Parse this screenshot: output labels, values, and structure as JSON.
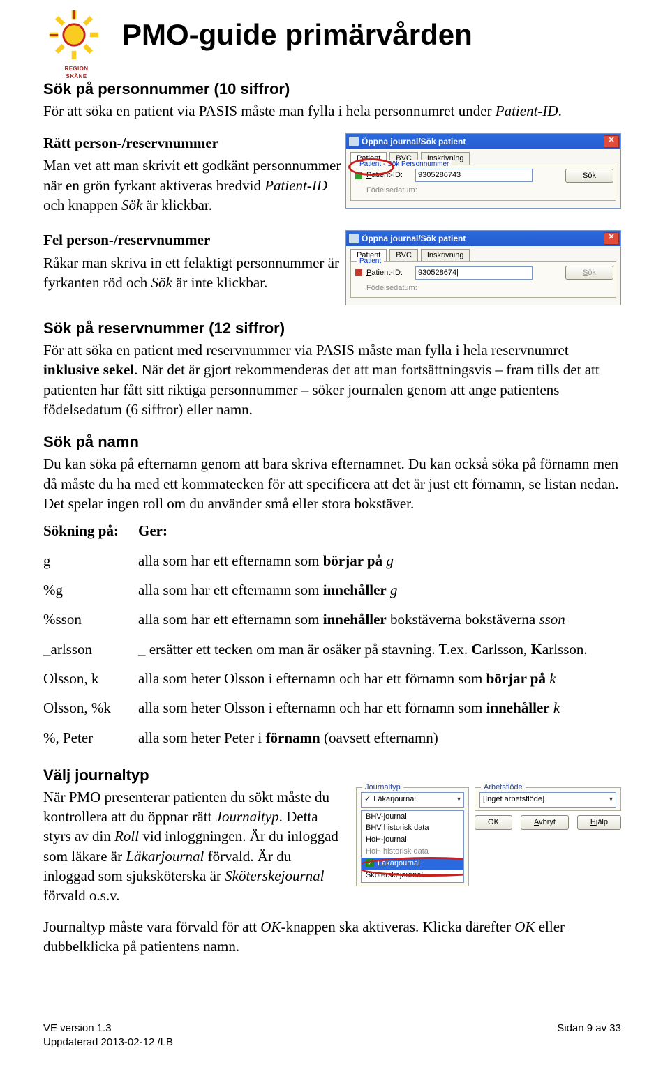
{
  "header": {
    "logo_region": "REGION",
    "logo_skane": "SKÅNE",
    "title": "PMO-guide primärvården"
  },
  "sec1": {
    "heading": "Sök på personnummer (10 siffror)",
    "p1a": "För att söka en patient via PASIS måste man fylla i hela personnumret under ",
    "p1b": "Patient-ID",
    "p1c": "."
  },
  "sec2": {
    "bold": "Rätt person-/reservnummer",
    "p1a": "Man vet att man skrivit ett godkänt personnummer när en grön fyrkant aktiveras bredvid ",
    "p1b": "Patient-ID",
    "p1c": " och knappen ",
    "p1d": "Sök",
    "p1e": " är klickbar."
  },
  "sec3": {
    "bold": "Fel person-/reservnummer",
    "p1a": "Råkar man skriva in ett felaktigt personnummer är fyrkanten röd och ",
    "p1b": "Sök",
    "p1c": " är inte klickbar."
  },
  "sec4": {
    "heading": "Sök på reservnummer (12 siffror)",
    "p1a": "För att söka en patient med reservnummer via PASIS måste man fylla i hela reservnumret ",
    "p1b": "inklusive sekel",
    "p1c": ". När det är gjort rekommenderas det att man fortsättningsvis – fram tills det att patienten har fått sitt riktiga personnummer – söker journalen genom att ange patientens födelsedatum (6 siffror) eller namn."
  },
  "sec5": {
    "heading": "Sök på namn",
    "p1": "Du kan söka på efternamn genom att bara skriva efternamnet. Du kan också söka på förnamn men då måste du ha med ett kommatecken för att specificera att det är just ett förnamn, se listan nedan. Det spelar ingen roll om du använder små eller stora bokstäver."
  },
  "table": {
    "h1": "Sökning på:",
    "h2": "Ger:",
    "rows": [
      {
        "k": "g",
        "v_a": "alla som har ett efternamn som ",
        "v_b": "börjar på",
        "v_c": " g",
        "v_it": true
      },
      {
        "k": "%g",
        "v_a": "alla som har ett efternamn som ",
        "v_b": "innehåller",
        "v_c": " g",
        "v_it": true
      },
      {
        "k": "%sson",
        "v_a": "alla som har ett efternamn som ",
        "v_b": "innehåller",
        "v_c": " bokstäverna ",
        "v_d": "sson",
        "v_it": true
      },
      {
        "k": "_arlsson",
        "v_a": "_ ersätter ett tecken om man är osäker på stavning. T.ex. ",
        "v_b": "C",
        "v_c": "arlsson, ",
        "v_d": "K",
        "v_e": "arlsson."
      },
      {
        "k": "Olsson, k",
        "v_a": "alla som heter Olsson i efternamn och har ett förnamn som ",
        "v_b": "börjar på",
        "v_c": " k",
        "v_it": true
      },
      {
        "k": "Olsson, %k",
        "v_a": "alla som heter Olsson i efternamn och har ett förnamn som ",
        "v_b": "innehåller",
        "v_c": " k",
        "v_it": true
      },
      {
        "k": "%, Peter",
        "v_a": "alla som heter Peter i ",
        "v_b": "förnamn",
        "v_c": " (oavsett efternamn)"
      }
    ]
  },
  "sec6": {
    "heading": "Välj journaltyp",
    "p1a": "När PMO presenterar patienten du sökt måste du kontrollera att du öppnar rätt ",
    "p1b": "Journaltyp",
    "p1c": ". Detta styrs av din ",
    "p1d": "Roll",
    "p1e": " vid inloggningen. Är du inloggad som läkare är ",
    "p1f": "Läkarjournal",
    "p1g": " förvald. Är du inloggad som sjuksköterska är ",
    "p1h": "Sköterskejournal",
    "p1i": " förvald o.s.v.",
    "p2a": "Journaltyp måste vara förvald för att ",
    "p2b": "OK",
    "p2c": "-knappen ska aktiveras. Klicka därefter ",
    "p2d": "OK",
    "p2e": " eller dubbelklicka på patientens namn."
  },
  "shot1": {
    "title": "Öppna journal/Sök patient",
    "tabs": [
      "Patient",
      "BVC",
      "Inskrivning"
    ],
    "legend": "Patient - Sök Personnummer",
    "field_label_a": "P",
    "field_label_b": "atient-ID:",
    "value": "9305286743",
    "fodelsedatum": "Födelsedatum:",
    "sok_u": "S",
    "sok_r": "ök"
  },
  "shot2": {
    "title": "Öppna journal/Sök patient",
    "tabs": [
      "Patient",
      "BVC",
      "Inskrivning"
    ],
    "legend": "Patient",
    "field_label_a": "P",
    "field_label_b": "atient-ID:",
    "value": "930528674|",
    "fodelsedatum": "Födelsedatum:",
    "sok_u": "S",
    "sok_r": "ök"
  },
  "shot3": {
    "jt_legend": "Journaltyp",
    "jt_selected": "Läkarjournal",
    "jt_items": [
      "BHV-journal",
      "BHV historisk data",
      "HoH-journal",
      "HoH historisk data",
      "Läkarjournal",
      "Sköterskejournal"
    ],
    "af_legend": "Arbetsflöde",
    "af_value": "[Inget arbetsflöde]",
    "btn_ok": "OK",
    "btn_avbryt_u": "A",
    "btn_avbryt_r": "vbryt",
    "btn_hjalp_u": "H",
    "btn_hjalp_r": "jälp"
  },
  "footer": {
    "left1": "VE version 1.3",
    "left2": "Uppdaterad 2013-02-12 /LB",
    "right": "Sidan 9 av 33"
  },
  "glyphs": {
    "check": "✓",
    "chev": "▾",
    "close": "✕"
  }
}
